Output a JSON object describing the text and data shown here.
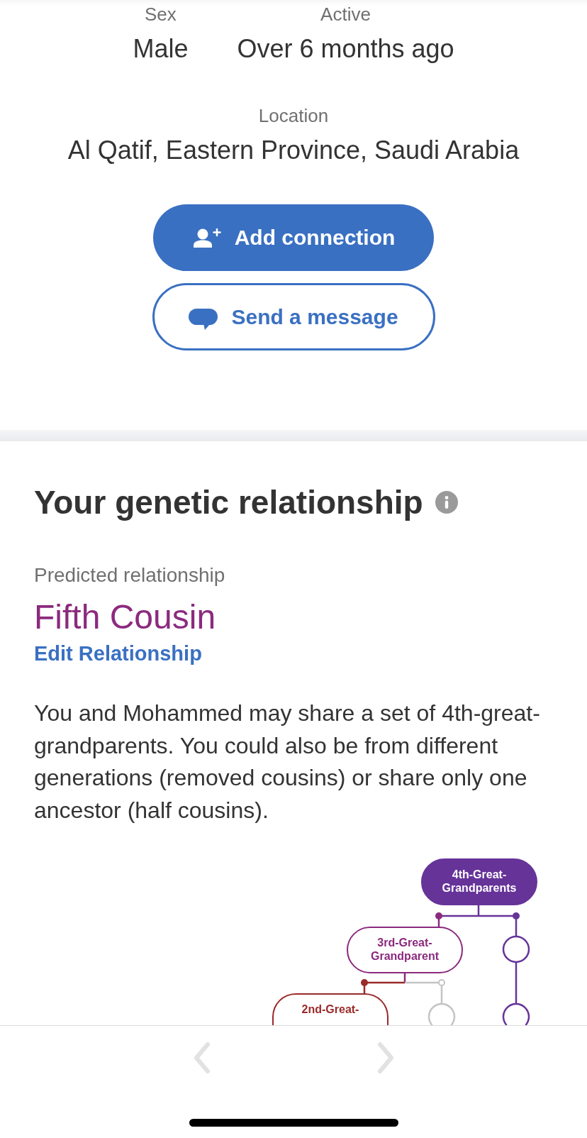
{
  "profile": {
    "fields": [
      {
        "label": "Sex",
        "value": "Male"
      },
      {
        "label": "Active",
        "value": "Over 6 months ago"
      }
    ],
    "location": {
      "label": "Location",
      "value": "Al Qatif, Eastern Province, Saudi Arabia"
    },
    "actions": [
      {
        "kind": "primary",
        "label": "Add connection"
      },
      {
        "kind": "secondary",
        "label": "Send a message"
      }
    ]
  },
  "genetic_relationship": {
    "title": "Your genetic relationship",
    "predicted_label": "Predicted relationship",
    "relationship": "Fifth Cousin",
    "edit_link": "Edit Relationship",
    "description": "You and Mohammed may share a set of 4th-great-grandparents. You could also be from different generations (removed cousins) or share only one ancestor (half cousins).",
    "diagram": {
      "nodes": [
        {
          "kind": "filled",
          "label": "4th-Great-Grandparents",
          "color": "#663399"
        },
        {
          "kind": "outlined",
          "label": "3rd-Great-Grandparent",
          "color": "#8b2a7e"
        },
        {
          "kind": "outlined",
          "label": "2nd-Great-",
          "color": "#9b2a2a"
        },
        {
          "kind": "circle",
          "color": "#663399"
        },
        {
          "kind": "circle",
          "color": "#663399"
        },
        {
          "kind": "circle",
          "color": "#c4c4c4"
        }
      ]
    }
  },
  "bottom_nav": {
    "buttons": [
      {
        "kind": "previous",
        "disabled": true
      },
      {
        "kind": "next",
        "disabled": true
      }
    ]
  }
}
